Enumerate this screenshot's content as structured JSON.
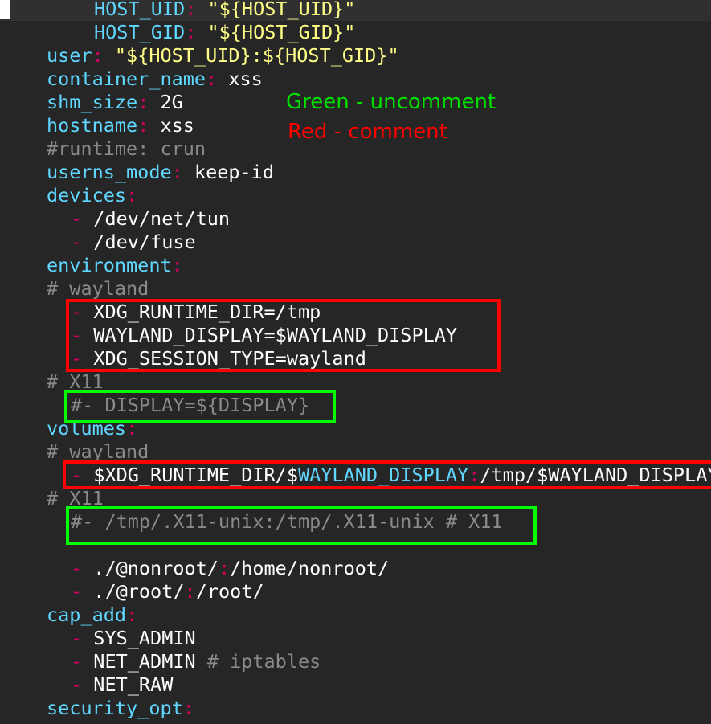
{
  "colors": {
    "background": "#262626",
    "key": "#5fd7ff",
    "punct": "#d7005f",
    "string": "#ffff87",
    "comment": "#8a8a8a",
    "legend_green": "#00e000",
    "legend_red": "#ff0000"
  },
  "legend": {
    "green": "Green - uncomment",
    "red": "Red - comment"
  },
  "code": {
    "l1_key": "HOST_UID",
    "l1_colon": ":",
    "l1_val": " \"${HOST_UID}\"",
    "l2_key": "HOST_GID",
    "l2_colon": ":",
    "l2_val": " \"${HOST_GID}\"",
    "l3_key": "user",
    "l3_colon": ":",
    "l3_val": " \"${HOST_UID}:${HOST_GID}\"",
    "l4_key": "container_name",
    "l4_colon": ":",
    "l4_val": " xss",
    "l5_key": "shm_size",
    "l5_colon": ":",
    "l5_val": " 2G",
    "l6_key": "hostname",
    "l6_colon": ":",
    "l6_val": " xss",
    "l7_comment": "#runtime: crun",
    "l8_key": "userns_mode",
    "l8_colon": ":",
    "l8_val": " keep-id",
    "l9_key": "devices",
    "l9_colon": ":",
    "l10_dash": "-",
    "l10_val": " /dev/net/tun",
    "l11_dash": "-",
    "l11_val": " /dev/fuse",
    "l12_key": "environment",
    "l12_colon": ":",
    "l13_comment": "# wayland",
    "l14_dash": "-",
    "l14_val": " XDG_RUNTIME_DIR=/tmp",
    "l15_dash": "-",
    "l15_val": " WAYLAND_DISPLAY=$WAYLAND_DISPLAY",
    "l16_dash": "-",
    "l16_val": " XDG_SESSION_TYPE=wayland",
    "l17_comment": "# X11",
    "l18_comment": "#- DISPLAY=${DISPLAY}",
    "l19_key": "volumes",
    "l19_colon": ":",
    "l20_comment": "# wayland",
    "l21_dash": "-",
    "l21_val_a": " $XDG_RUNTIME_DIR/$",
    "l21_val_b": "WAYLAND_DISPLAY",
    "l21_colon": ":",
    "l21_val_c": "/tmp/$WAYLAND_DISPLAY",
    "l22_comment": "# X11",
    "l23_comment": "#- /tmp/.X11-unix:/tmp/.X11-unix # X11",
    "l25_dash": "-",
    "l25_val_a": " ./@nonroot/",
    "l25_colon": ":",
    "l25_val_b": "/home/nonroot/",
    "l26_dash": "-",
    "l26_val_a": " ./@root/",
    "l26_colon": ":",
    "l26_val_b": "/root/",
    "l27_key": "cap_add",
    "l27_colon": ":",
    "l28_dash": "-",
    "l28_val": " SYS_ADMIN",
    "l29_dash": "-",
    "l29_val": " NET_ADMIN",
    "l29_comment": " # iptables",
    "l30_dash": "-",
    "l30_val": " NET_RAW",
    "l31_key": "security_opt",
    "l31_colon": ":"
  }
}
